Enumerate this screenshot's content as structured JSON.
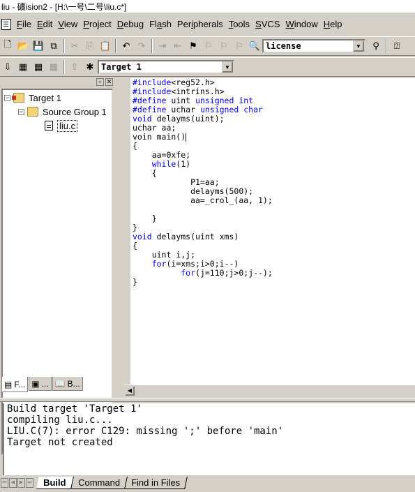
{
  "window": {
    "title": "liu  - 礦ision2 - [H:\\一号\\二号\\liu.c*]"
  },
  "menu": [
    {
      "label": "File",
      "key": "F"
    },
    {
      "label": "Edit",
      "key": "E"
    },
    {
      "label": "View",
      "key": "V"
    },
    {
      "label": "Project",
      "key": "P"
    },
    {
      "label": "Debug",
      "key": "D"
    },
    {
      "label": "Flash",
      "key": "a"
    },
    {
      "label": "Peripherals",
      "key": "i"
    },
    {
      "label": "Tools",
      "key": "T"
    },
    {
      "label": "SVCS",
      "key": "S"
    },
    {
      "label": "Window",
      "key": "W"
    },
    {
      "label": "Help",
      "key": "H"
    }
  ],
  "toolbar1": {
    "find_combo_value": "license"
  },
  "toolbar2": {
    "target_combo_value": "Target 1"
  },
  "project": {
    "target": "Target 1",
    "group": "Source Group 1",
    "file": "liu.c",
    "tabs": [
      "F...",
      "...",
      "B..."
    ]
  },
  "editor": {
    "lines": [
      [
        {
          "t": "#include",
          "k": 1
        },
        {
          "t": "<reg52.h>"
        }
      ],
      [
        {
          "t": "#include",
          "k": 1
        },
        {
          "t": "<intrins.h>"
        }
      ],
      [
        {
          "t": "#define",
          "k": 1
        },
        {
          "t": " uint "
        },
        {
          "t": "unsigned int",
          "k": 1
        }
      ],
      [
        {
          "t": "#define",
          "k": 1
        },
        {
          "t": " uchar "
        },
        {
          "t": "unsigned char",
          "k": 1
        }
      ],
      [
        {
          "t": "void",
          "k": 1
        },
        {
          "t": " delayms(uint);"
        }
      ],
      [
        {
          "t": "uchar aa;"
        }
      ],
      [
        {
          "t": "voin main()"
        }
      ],
      [
        {
          "t": "{"
        }
      ],
      [
        {
          "t": "    aa=0xfe;"
        }
      ],
      [
        {
          "t": "    "
        },
        {
          "t": "while",
          "k": 1
        },
        {
          "t": "(1)"
        }
      ],
      [
        {
          "t": "    {"
        }
      ],
      [
        {
          "t": "            P1=aa;"
        }
      ],
      [
        {
          "t": "            delayms(500);"
        }
      ],
      [
        {
          "t": "            aa=_crol_(aa, 1);"
        }
      ],
      [
        {
          "t": ""
        }
      ],
      [
        {
          "t": "    }"
        }
      ],
      [
        {
          "t": "}"
        }
      ],
      [
        {
          "t": "void",
          "k": 1
        },
        {
          "t": " delayms(uint xms)"
        }
      ],
      [
        {
          "t": "{"
        }
      ],
      [
        {
          "t": "    uint i,j;"
        }
      ],
      [
        {
          "t": "    "
        },
        {
          "t": "for",
          "k": 1
        },
        {
          "t": "(i=xms;i>0;i--)"
        }
      ],
      [
        {
          "t": "          "
        },
        {
          "t": "for",
          "k": 1
        },
        {
          "t": "(j=110;j>0;j--);"
        }
      ],
      [
        {
          "t": "}"
        }
      ]
    ]
  },
  "output": {
    "lines": [
      "Build target 'Target 1'",
      "compiling liu.c...",
      "LIU.C(7): error C129: missing ';' before 'main'",
      "Target not created"
    ],
    "tabs": [
      "Build",
      "Command",
      "Find in Files"
    ],
    "active_tab": "Build"
  },
  "colors": {
    "keyword": "#0000ff",
    "face": "#d4d0c8"
  }
}
